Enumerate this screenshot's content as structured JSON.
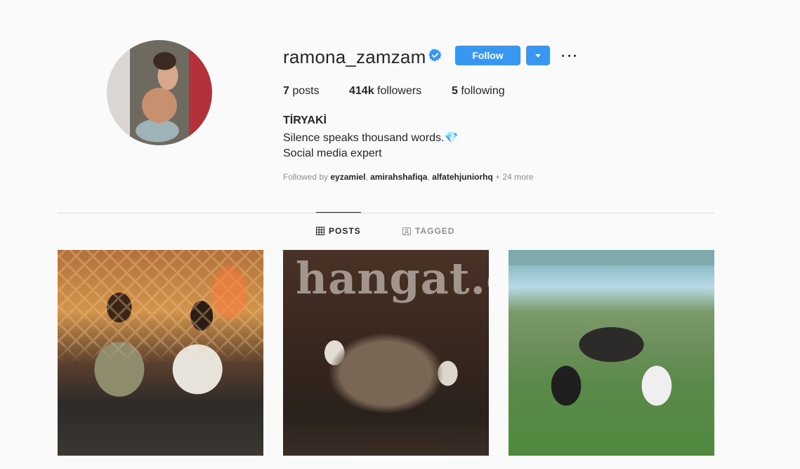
{
  "profile": {
    "username": "ramona_zamzam",
    "follow_label": "Follow",
    "stats": {
      "posts_count": "7",
      "posts_label": "posts",
      "followers_count": "414k",
      "followers_label": "followers",
      "following_count": "5",
      "following_label": "following"
    },
    "full_name": "TİRYAKİ",
    "bio_line1": "Silence speaks thousand words.💎",
    "bio_line2": "Social media expert",
    "followed_by_prefix": "Followed by ",
    "followed_by_users": [
      "eyzamiel",
      "amirahshafiqa",
      "alfatehjuniorhq"
    ],
    "followed_by_more": "+ 24 more",
    "accent_color": "#3897f0"
  },
  "tabs": [
    {
      "label": "POSTS",
      "active": true
    },
    {
      "label": "TAGGED",
      "active": false
    }
  ],
  "posts": {
    "watermark_text": "hangat.c"
  }
}
